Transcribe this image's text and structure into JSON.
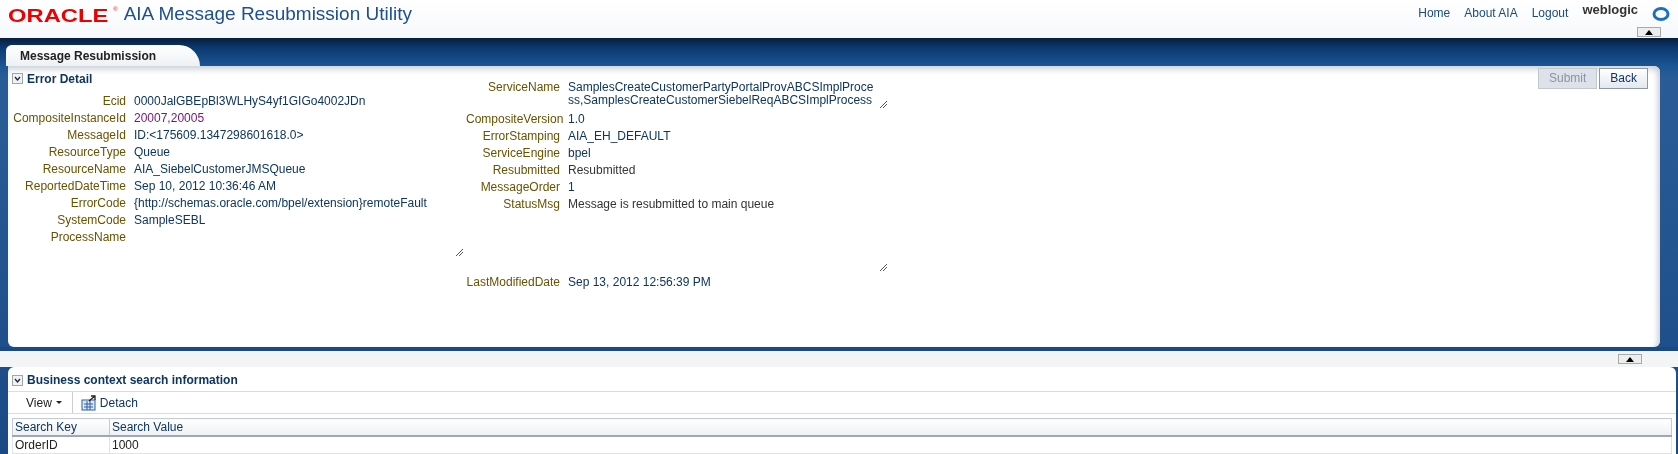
{
  "header": {
    "logo": "ORACLE",
    "logo_mark": "®",
    "title": "AIA Message Resubmission Utility",
    "links": [
      "Home",
      "About AIA",
      "Logout"
    ],
    "user": "weblogic"
  },
  "tabs": [
    {
      "label": "Message Resubmission",
      "selected": true
    }
  ],
  "error_detail": {
    "title": "Error Detail",
    "expanded": true,
    "buttons": [
      {
        "label": "Submit",
        "disabled": true
      },
      {
        "label": "Back",
        "disabled": false
      }
    ],
    "left_fields": [
      {
        "label": "Ecid",
        "value": "0000JalGBEpBl3WLHyS4yf1GIGo4002JDn",
        "kind": "text"
      },
      {
        "label": "CompositeInstanceId",
        "value": "20007,20005",
        "kind": "link"
      },
      {
        "label": "MessageId",
        "value": "ID:<175609.1347298601618.0>",
        "kind": "text"
      },
      {
        "label": "ResourceType",
        "value": "Queue",
        "kind": "text"
      },
      {
        "label": "ResourceName",
        "value": "AIA_SiebelCustomerJMSQueue",
        "kind": "text"
      },
      {
        "label": "ReportedDateTime",
        "value": "Sep 10, 2012 10:36:46 AM",
        "kind": "text"
      },
      {
        "label": "ErrorCode",
        "value": "{http://schemas.oracle.com/bpel/extension}remoteFault",
        "kind": "text"
      },
      {
        "label": "SystemCode",
        "value": "SampleSEBL",
        "kind": "text"
      },
      {
        "label": "ProcessName",
        "kind": "textarea"
      }
    ],
    "right_fields": [
      {
        "label": "ServiceName",
        "value": "SamplesCreateCustomerPartyPortalProvABCSImplProcess,SamplesCreateCustomerSiebelReqABCSImplProcess",
        "kind": "textarea"
      },
      {
        "label": "CompositeVersion",
        "value": "1.0",
        "kind": "text"
      },
      {
        "label": "ErrorStamping",
        "value": "AIA_EH_DEFAULT",
        "kind": "text"
      },
      {
        "label": "ServiceEngine",
        "value": "bpel",
        "kind": "text"
      },
      {
        "label": "Resubmitted",
        "value": "Resubmitted",
        "kind": "plain"
      },
      {
        "label": "MessageOrder",
        "value": "1",
        "kind": "text"
      },
      {
        "label": "StatusMsg",
        "value": "Message is resubmitted to main queue",
        "kind": "tallarea"
      },
      {
        "label": "LastModifiedDate",
        "value": "Sep 13, 2012 12:56:39 PM",
        "kind": "text"
      }
    ]
  },
  "business_context": {
    "title": "Business context search information",
    "expanded": true,
    "toolbar": {
      "view_menu": "View",
      "detach": "Detach"
    },
    "table": {
      "columns": [
        "Search Key",
        "Search Value"
      ],
      "rows": [
        [
          "OrderID",
          "1000"
        ]
      ]
    }
  }
}
